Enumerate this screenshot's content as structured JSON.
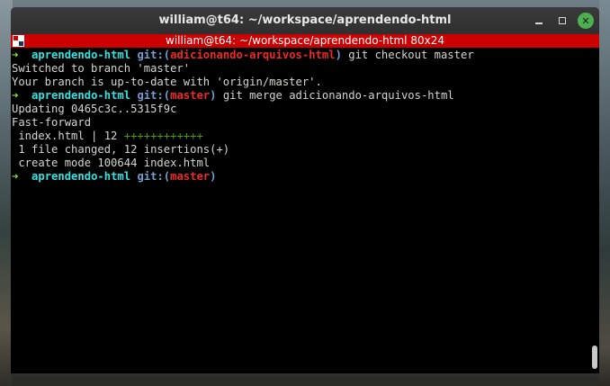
{
  "window": {
    "title": "william@t64: ~/workspace/aprendendo-html"
  },
  "tab": {
    "title": "william@t64: ~/workspace/aprendendo-html 80x24"
  },
  "terminal": {
    "lines": [
      {
        "type": "prompt",
        "arrow": "➜",
        "repo": "aprendendo-html",
        "git": "git:(",
        "branch": "adicionando-arquivos-html",
        "close": ")",
        "cmd": " git checkout master"
      },
      {
        "type": "text",
        "text": "Switched to branch 'master'"
      },
      {
        "type": "text",
        "text": "Your branch is up-to-date with 'origin/master'."
      },
      {
        "type": "prompt",
        "arrow": "➜",
        "repo": "aprendendo-html",
        "git": "git:(",
        "branch": "master",
        "close": ")",
        "cmd": " git merge adicionando-arquivos-html"
      },
      {
        "type": "text",
        "text": "Updating 0465c3c..5315f9c"
      },
      {
        "type": "text",
        "text": "Fast-forward"
      },
      {
        "type": "stat",
        "text": " index.html | 12 ",
        "plus": "++++++++++++"
      },
      {
        "type": "text",
        "text": " 1 file changed, 12 insertions(+)"
      },
      {
        "type": "text",
        "text": " create mode 100644 index.html"
      },
      {
        "type": "prompt",
        "arrow": "➜",
        "repo": "aprendendo-html",
        "git": "git:(",
        "branch": "master",
        "close": ")",
        "cmd": ""
      }
    ]
  },
  "colors": {
    "tab_bar": "#cc0000",
    "prompt_arrow": "#8ae234",
    "repo_name": "#34e2e2",
    "git_label": "#729fcf",
    "branch_name": "#ef2929",
    "diff_plus": "#4e9a06",
    "close_button": "#4caf50"
  },
  "icons": {
    "terminal_tab": "terminal-tab-icon",
    "minimize": "minimize-icon",
    "maximize": "maximize-icon",
    "close": "close-icon"
  }
}
